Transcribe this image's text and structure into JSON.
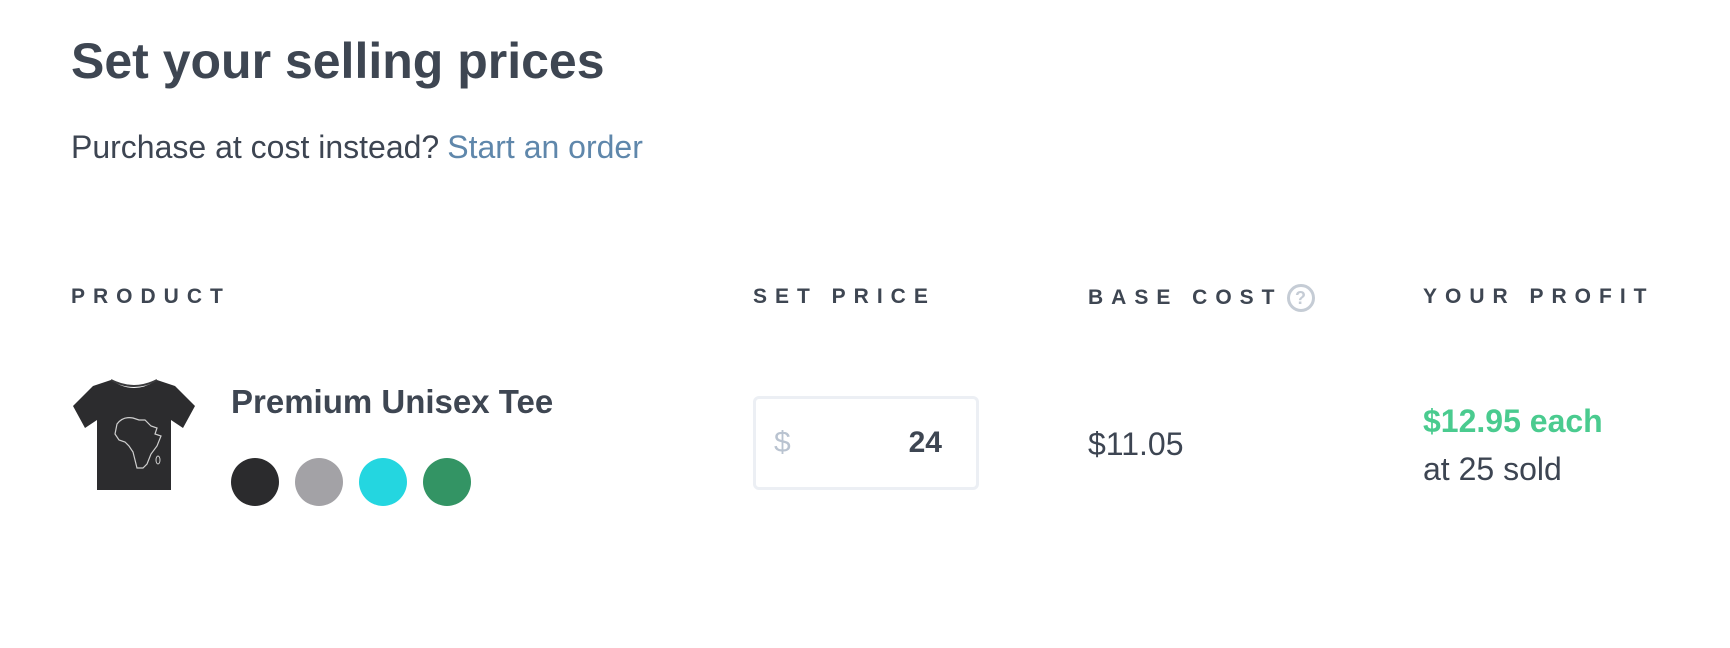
{
  "header": {
    "title": "Set your selling prices",
    "subtitle_prefix": "Purchase at cost instead?",
    "subtitle_link": "Start an order"
  },
  "table": {
    "columns": {
      "product": "PRODUCT",
      "set_price": "SET PRICE",
      "base_cost": "BASE COST",
      "your_profit": "YOUR PROFIT"
    },
    "help_icon_glyph": "?",
    "rows": [
      {
        "product_name": "Premium Unisex Tee",
        "thumbnail_icon": "black-tshirt-africa-outline",
        "swatches": [
          "#2b2b2d",
          "#a3a2a6",
          "#24d6e0",
          "#339464"
        ],
        "currency_symbol": "$",
        "price": "24",
        "base_cost": "$11.05",
        "profit_each": "$12.95 each",
        "profit_sold": "at 25 sold"
      }
    ]
  },
  "colors": {
    "link": "#5f87ab",
    "profit": "#4acb8f",
    "text": "#3e4652"
  }
}
